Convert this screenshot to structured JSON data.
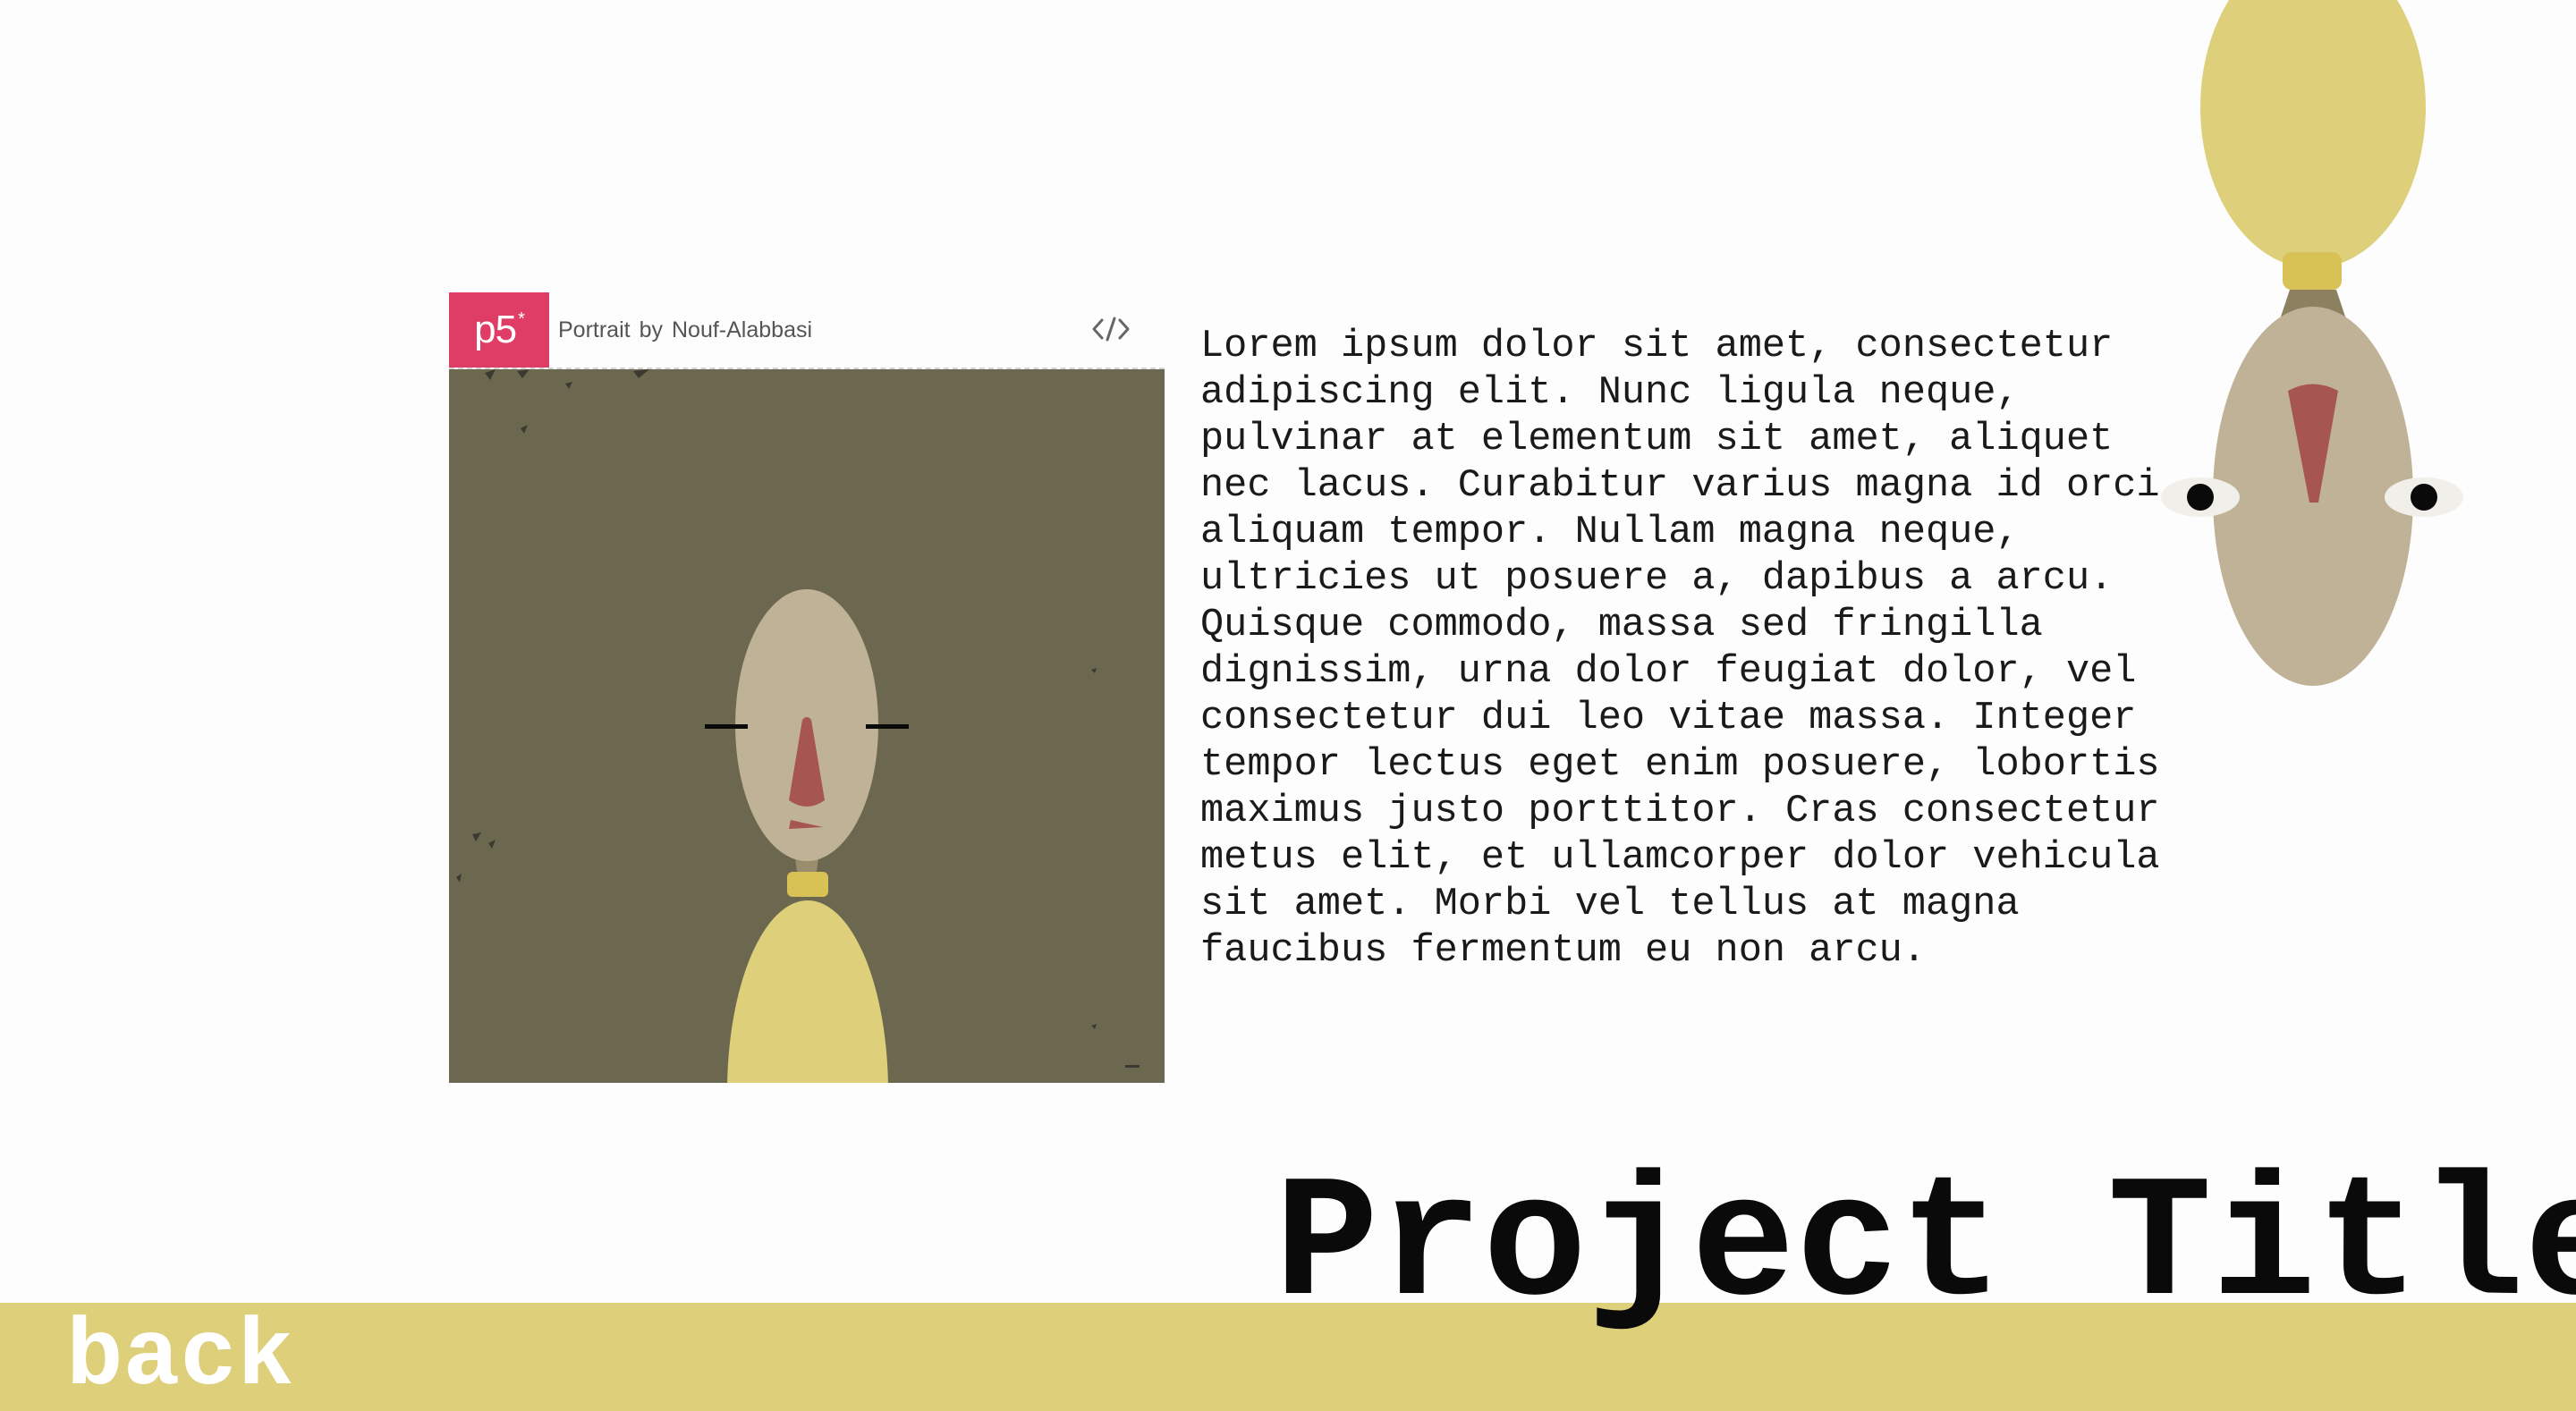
{
  "embed": {
    "logo_text": "p5",
    "logo_mark": "*",
    "sketch_title": "Portrait",
    "by_label": "by",
    "author": "Nouf-Alabbasi",
    "code_icon": "code-brackets-icon",
    "colors": {
      "logo_bg": "#e03d66",
      "sketch_bg": "#6c6850",
      "face": "#bfb296",
      "nose": "#a65550",
      "shirt": "#decf7b",
      "collar": "#d9c255"
    }
  },
  "body_text": "Lorem ipsum dolor sit amet, consectetur adipiscing elit. Nunc ligula neque, pulvinar at elementum sit amet, aliquet nec lacus. Curabitur varius magna id orci aliquam tempor. Nullam magna neque, ultricies ut posuere a, dapibus a arcu. Quisque commodo, massa sed fringilla dignissim, urna dolor feugiat dolor, vel consectetur dui leo vitae massa. Integer tempor lectus eget enim posuere, lobortis maximus justo porttitor. Cras consectetur metus elit, et ullamcorper dolor vehicula sit amet. Morbi vel tellus at magna faucibus fermentum eu non arcu.",
  "project_title": "Project Title",
  "footer": {
    "back_label": "back",
    "bar_color": "#decf7b"
  }
}
